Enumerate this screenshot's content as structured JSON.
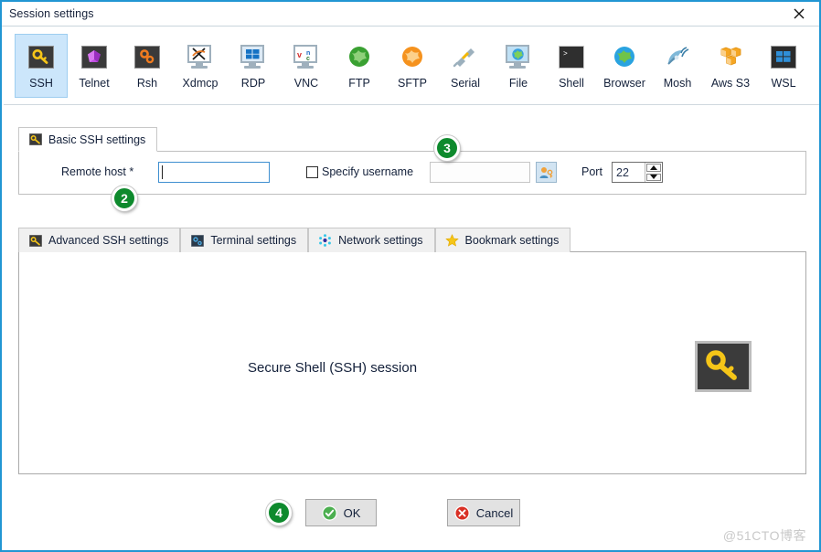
{
  "window": {
    "title": "Session settings",
    "close_icon": "close-icon"
  },
  "session_types": [
    {
      "id": "ssh",
      "label": "SSH",
      "icon": "key-tile-icon",
      "selected": true
    },
    {
      "id": "telnet",
      "label": "Telnet",
      "icon": "purple-cube-tile-icon",
      "selected": false
    },
    {
      "id": "rsh",
      "label": "Rsh",
      "icon": "orange-gears-tile-icon",
      "selected": false
    },
    {
      "id": "xdmcp",
      "label": "Xdmcp",
      "icon": "x-monitor-icon",
      "selected": false
    },
    {
      "id": "rdp",
      "label": "RDP",
      "icon": "windows-monitor-icon",
      "selected": false
    },
    {
      "id": "vnc",
      "label": "VNC",
      "icon": "vnc-monitor-icon",
      "selected": false
    },
    {
      "id": "ftp",
      "label": "FTP",
      "icon": "green-globe-icon",
      "selected": false
    },
    {
      "id": "sftp",
      "label": "SFTP",
      "icon": "orange-globe-icon",
      "selected": false
    },
    {
      "id": "serial",
      "label": "Serial",
      "icon": "serial-plug-icon",
      "selected": false
    },
    {
      "id": "file",
      "label": "File",
      "icon": "globe-monitor-icon",
      "selected": false
    },
    {
      "id": "shell",
      "label": "Shell",
      "icon": "terminal-tile-icon",
      "selected": false
    },
    {
      "id": "browser",
      "label": "Browser",
      "icon": "blue-globe-icon",
      "selected": false
    },
    {
      "id": "mosh",
      "label": "Mosh",
      "icon": "satellite-dish-icon",
      "selected": false
    },
    {
      "id": "awss3",
      "label": "Aws S3",
      "icon": "aws-buckets-icon",
      "selected": false
    },
    {
      "id": "wsl",
      "label": "WSL",
      "icon": "windows-tile-icon",
      "selected": false
    }
  ],
  "basic": {
    "tab_label": "Basic SSH settings",
    "tab_icon": "key-tile-icon",
    "remote_host_label": "Remote host *",
    "remote_host_value": "",
    "specify_username_label": "Specify username",
    "specify_username_checked": false,
    "username_value": "",
    "user_picker_icon": "user-key-icon",
    "port_label": "Port",
    "port_value": "22",
    "spinner_up_icon": "chevron-up-icon",
    "spinner_down_icon": "chevron-down-icon"
  },
  "lower_tabs": [
    {
      "id": "advanced",
      "label": "Advanced SSH settings",
      "icon": "key-tile-icon",
      "active": false
    },
    {
      "id": "terminal",
      "label": "Terminal settings",
      "icon": "terminal-blue-icon",
      "active": false
    },
    {
      "id": "network",
      "label": "Network settings",
      "icon": "network-dots-icon",
      "active": false
    },
    {
      "id": "bookmark",
      "label": "Bookmark settings",
      "icon": "star-icon",
      "active": false
    }
  ],
  "panel": {
    "caption": "Secure Shell (SSH) session",
    "illustration_icon": "key-tile-icon"
  },
  "footer": {
    "ok_label": "OK",
    "ok_icon": "check-circle-icon",
    "cancel_label": "Cancel",
    "cancel_icon": "x-circle-icon"
  },
  "callouts": [
    {
      "id": "callout-2",
      "label": "2"
    },
    {
      "id": "callout-3",
      "label": "3"
    },
    {
      "id": "callout-4",
      "label": "4"
    }
  ],
  "watermark": "@51CTO博客",
  "colors": {
    "accent": "#2196d3",
    "selected_tile": "#cce6fb",
    "badge_green": "#0e8a2d",
    "ok_green": "#4caf50",
    "cancel_red": "#d93025",
    "key_yellow": "#f5c518"
  }
}
